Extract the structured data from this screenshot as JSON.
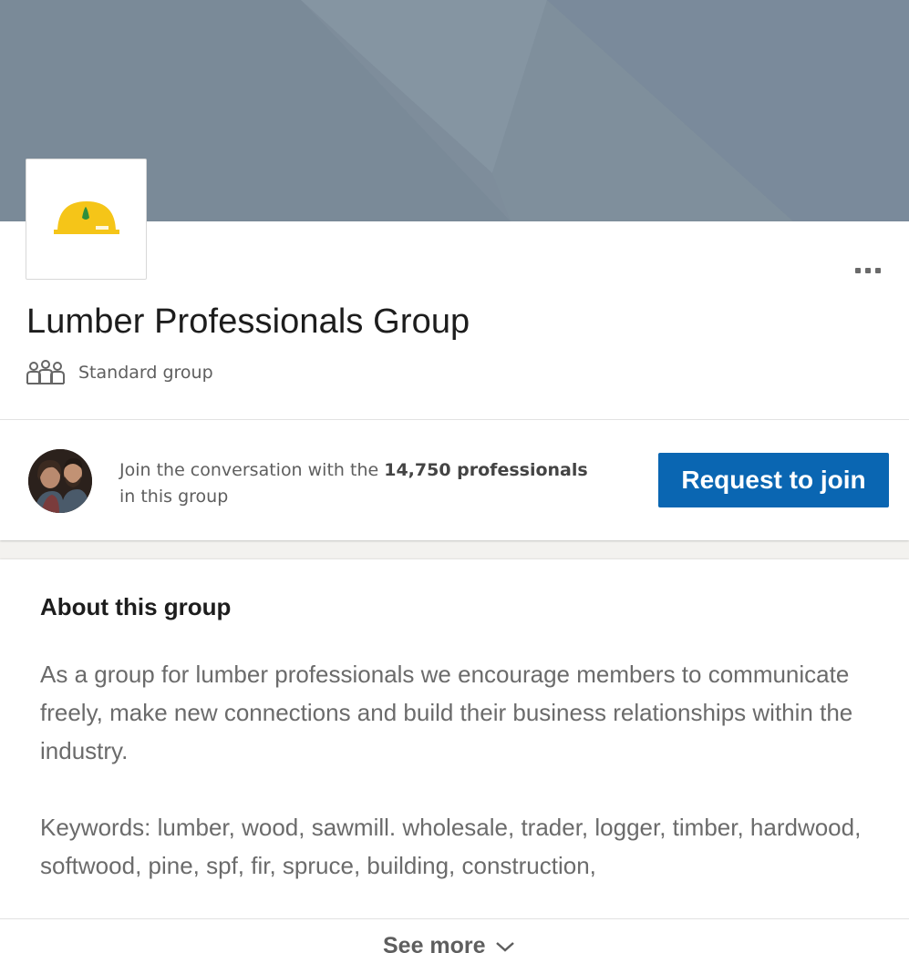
{
  "group": {
    "name": "Lumber Professionals Group",
    "type_label": "Standard group",
    "type_icon": "people-icon",
    "logo_icon": "hard-hat-logo",
    "more_icon": "more-horizontal-icon"
  },
  "join": {
    "prefix": "Join the conversation with the ",
    "member_count": "14,750 professionals",
    "suffix": " in this group",
    "button_label": "Request to join"
  },
  "about": {
    "title": "About this group",
    "paragraphs": [
      "As a group for lumber professionals we encourage members to communicate freely, make new connections and build their business relationships within the industry.",
      "Keywords: lumber, wood, sawmill. wholesale, trader, logger, timber, hardwood, softwood, pine, spf, fir, spruce, building, construction,"
    ],
    "see_more_label": "See more",
    "see_more_icon": "chevron-down-icon"
  },
  "colors": {
    "cover": "#7d8c99",
    "primary_button": "#0a66b2",
    "logo_hat": "#f5c518"
  }
}
